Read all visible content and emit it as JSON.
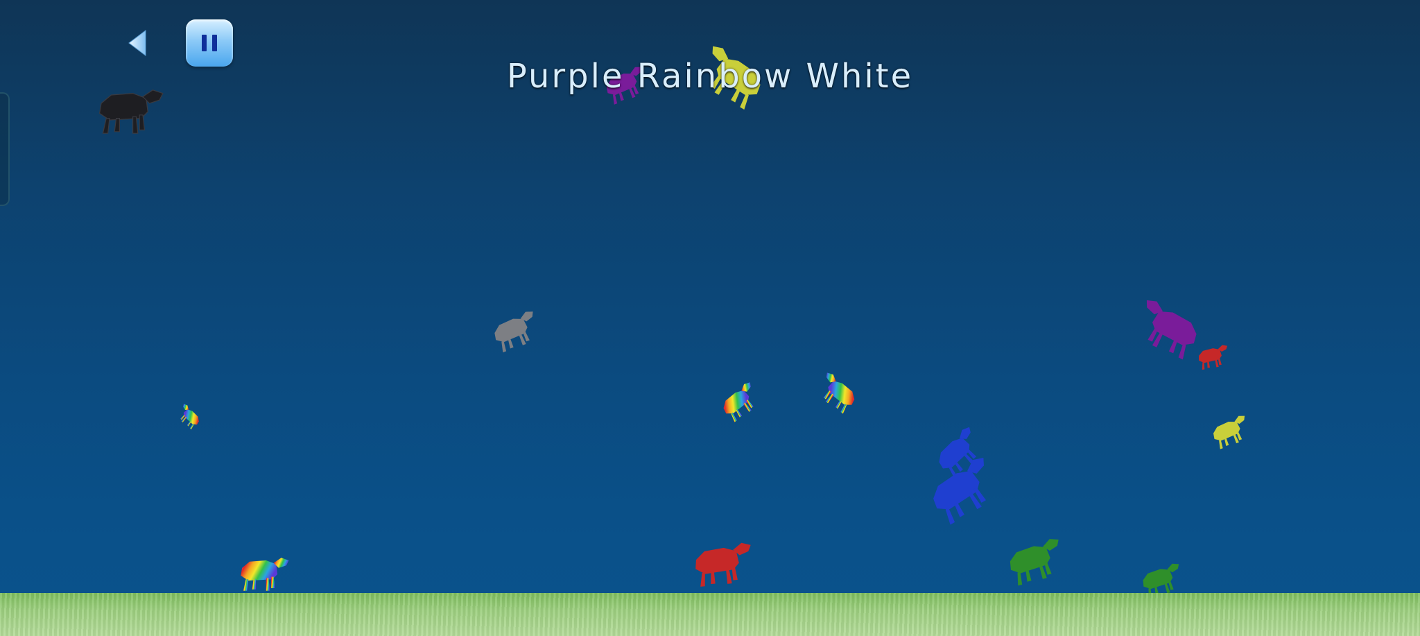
{
  "hud": {
    "back_icon": "back-arrow-icon",
    "pause_icon": "pause-icon",
    "target_colors": "Purple Rainbow White"
  },
  "sheep_colors": {
    "black": "#1e1e22",
    "gray": "#7d7f84",
    "purple": "#7a1c9a",
    "yellow": "#c9cf3a",
    "red": "#c62828",
    "blue": "#1f3fd0",
    "green": "#2f8f2a"
  },
  "ground_color": "#9ccf7c"
}
